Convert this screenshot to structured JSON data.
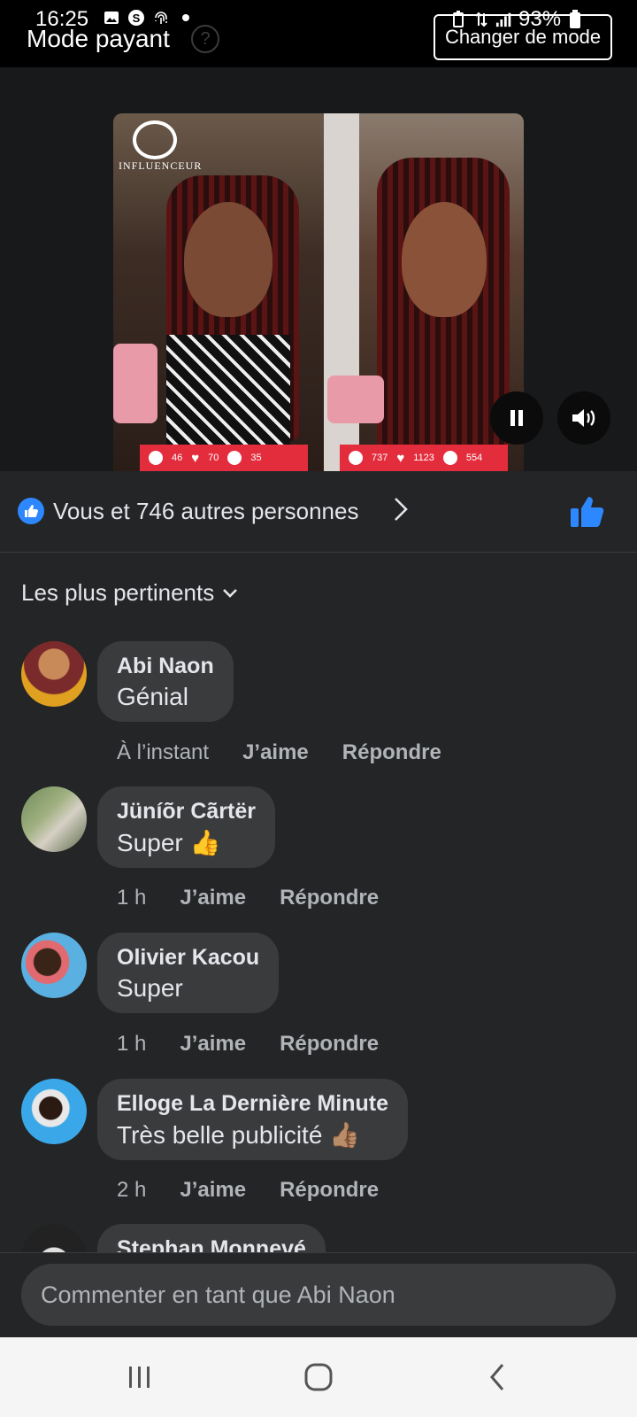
{
  "status_bar": {
    "time": "16:25",
    "battery": "93%"
  },
  "header": {
    "mode_title": "Mode payant",
    "help_symbol": "?",
    "change_mode_label": "Changer de mode"
  },
  "video": {
    "logo_text": "INFLUENCEUR",
    "left_stats": {
      "comments": "46",
      "likes": "70",
      "shares": "35"
    },
    "right_stats": {
      "comments": "737",
      "likes": "1123",
      "shares": "554"
    }
  },
  "likes": {
    "text": "Vous et 746 autres personnes"
  },
  "sort": {
    "label": "Les plus pertinents"
  },
  "comments": [
    {
      "author": "Abi Naon",
      "text": "Génial",
      "time": "À l’instant",
      "like": "J’aime",
      "reply": "Répondre"
    },
    {
      "author": "Jüníõr Cãrtër",
      "text": "Super 👍",
      "time": "1 h",
      "like": "J’aime",
      "reply": "Répondre"
    },
    {
      "author": "Olivier Kacou",
      "text": "Super",
      "time": "1 h",
      "like": "J’aime",
      "reply": "Répondre"
    },
    {
      "author": "Elloge La Dernière Minute",
      "text": "Très belle publicité 👍🏽",
      "time": "2 h",
      "like": "J’aime",
      "reply": "Répondre"
    },
    {
      "author": "Stephan Monnevé"
    }
  ],
  "composer": {
    "placeholder": "Commenter en tant que Abi Naon"
  },
  "colors": {
    "background": "#242526",
    "bubble": "#3a3b3c",
    "accent": "#2d88ff",
    "stats_bar": "#e32d3c"
  }
}
